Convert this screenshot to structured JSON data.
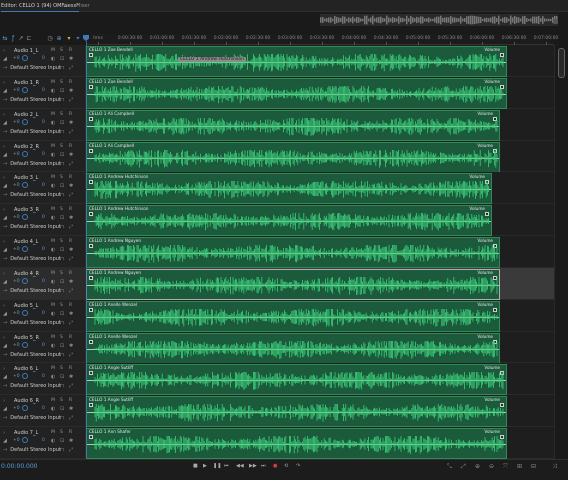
{
  "header": {
    "active_tab": "Editor: CELLO 1 (94) OMF.sesx*",
    "tab_menu_icon": "menu-icon",
    "second_tab": "Mixer"
  },
  "ruler": {
    "labels": [
      "hms",
      "0:00:30:00",
      "0:01:00:00",
      "0:01:30:00",
      "0:02:00:00",
      "0:02:30:00",
      "0:03:00:00",
      "0:03:30:00",
      "0:04:00:00",
      "0:04:30:00",
      "0:05:00:00",
      "0:05:30:00",
      "0:06:00:00",
      "0:06:30:00",
      "0:07:00:00"
    ]
  },
  "tooltip": "CELLO 1 Andrew Hutchinson",
  "colors": {
    "clip_fill": "#1b5a3b",
    "waveform": "#3ecf7c",
    "accent": "#3d7ab8",
    "record": "#d04040"
  },
  "track_common": {
    "m": "M",
    "s": "S",
    "r": "R",
    "volume": "+0",
    "pan": "0",
    "output": "Default Stereo Input",
    "clip_volume": "Volume"
  },
  "tracks": [
    {
      "name": "Audio 1_L",
      "clip": "CELLO 1 Zoe Bendell",
      "clip_end": 0.9,
      "selected": false
    },
    {
      "name": "Audio 1_R",
      "clip": "CELLO 1 Zoe Bendell",
      "clip_end": 0.9,
      "selected": false
    },
    {
      "name": "Audio 2_L",
      "clip": "CELLO 1 Ali Campbell",
      "clip_end": 0.885,
      "selected": false
    },
    {
      "name": "Audio 2_R",
      "clip": "CELLO 1 Ali Campbell",
      "clip_end": 0.885,
      "selected": false
    },
    {
      "name": "Audio 3_L",
      "clip": "CELLO 1 Andrew Hutchinson",
      "clip_end": 0.868,
      "selected": false
    },
    {
      "name": "Audio 3_R",
      "clip": "CELLO 1 Andrew Hutchinson",
      "clip_end": 0.868,
      "selected": false
    },
    {
      "name": "Audio 4_L",
      "clip": "CELLO 1 Andrew Nguyen",
      "clip_end": 0.885,
      "selected": false
    },
    {
      "name": "Audio 4_R",
      "clip": "CELLO 1 Andrew Nguyen",
      "clip_end": 0.885,
      "selected": true
    },
    {
      "name": "Audio 5_L",
      "clip": "CELLO 1 Anelle Wenzel",
      "clip_end": 0.885,
      "selected": false
    },
    {
      "name": "Audio 5_R",
      "clip": "CELLO 1 Anelle Wenzel",
      "clip_end": 0.885,
      "selected": false
    },
    {
      "name": "Audio 6_L",
      "clip": "CELLO 1 Angie Sutliff",
      "clip_end": 0.9,
      "selected": false
    },
    {
      "name": "Audio 6_R",
      "clip": "CELLO 1 Angie Sutliff",
      "clip_end": 0.9,
      "selected": false
    },
    {
      "name": "Audio 7_L",
      "clip": "CELLO 1 Ann Shafer",
      "clip_end": 0.9,
      "selected": false
    }
  ],
  "transport": {
    "timecode": "0:00:00.000",
    "buttons": [
      "stop-icon",
      "play-icon",
      "pause-icon",
      "go-to-start-icon",
      "rewind-icon",
      "fast-forward-icon",
      "go-to-end-icon",
      "record-icon",
      "loop-icon",
      "skip-selection-icon"
    ]
  }
}
